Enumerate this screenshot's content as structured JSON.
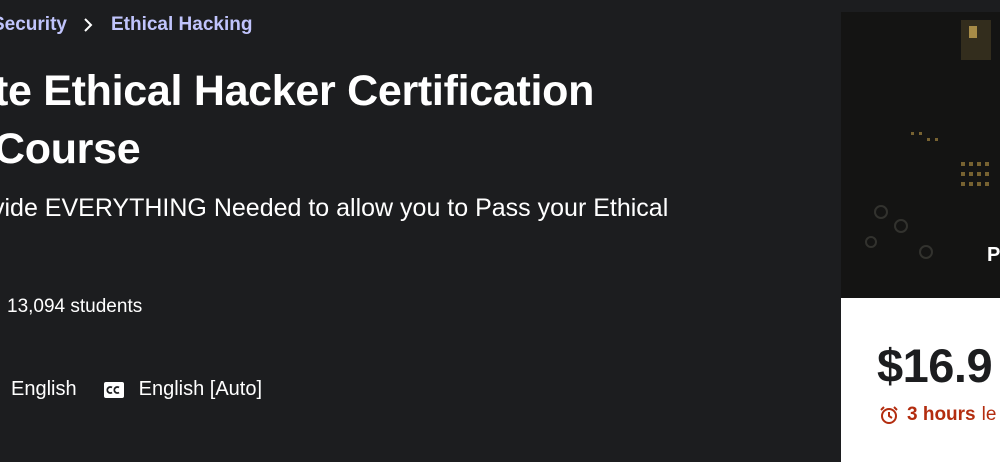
{
  "breadcrumb": {
    "items": [
      "Security",
      "Ethical Hacking"
    ]
  },
  "course": {
    "title_line1": "te Ethical Hacker Certification",
    "title_line2": "Course",
    "subtitle": "vide EVERYTHING Needed to allow you to Pass your Ethical",
    "students": "13,094 students",
    "language": "English",
    "captions": "English [Auto]"
  },
  "sidebar": {
    "preview_label": "P",
    "price": "$16.9",
    "timer_bold": "3 hours",
    "timer_rest": "le"
  },
  "colors": {
    "background": "#1c1d1f",
    "breadcrumb_link": "#c0c4fc",
    "timer_red": "#b32d0f"
  },
  "icons": [
    "chevron-right-icon",
    "closed-captions-icon",
    "alarm-clock-icon"
  ]
}
